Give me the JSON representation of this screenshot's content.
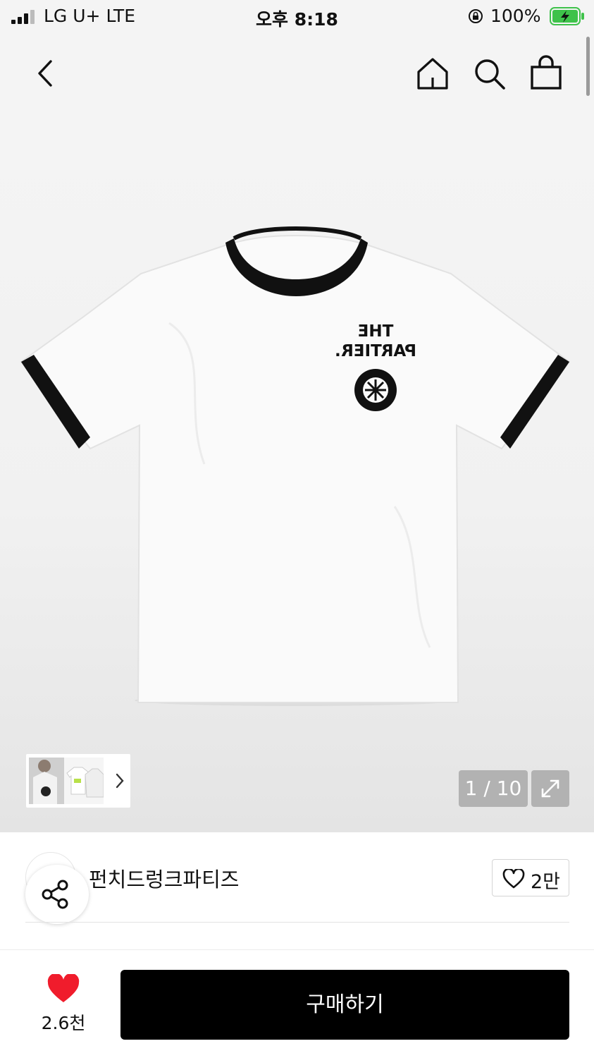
{
  "status_bar": {
    "carrier": "LG U+   LTE",
    "time": "오후 8:18",
    "battery": "100%"
  },
  "nav": {
    "back_icon": "chevron-left-icon",
    "home_icon": "home-icon",
    "search_icon": "search-icon",
    "cart_icon": "shopping-bag-icon"
  },
  "product_image": {
    "print_line1": "THE",
    "print_line2": "PARTIER.",
    "counter": "1 / 10",
    "expand_icon": "expand-icon"
  },
  "brand": {
    "name": "펀치드렁크파티즈",
    "like_count": "2만"
  },
  "bottom": {
    "likes": "2.6천",
    "buy_label": "구매하기"
  },
  "colors": {
    "heart": "#f01c2c",
    "button": "#000000",
    "battery": "#3ec24a"
  }
}
